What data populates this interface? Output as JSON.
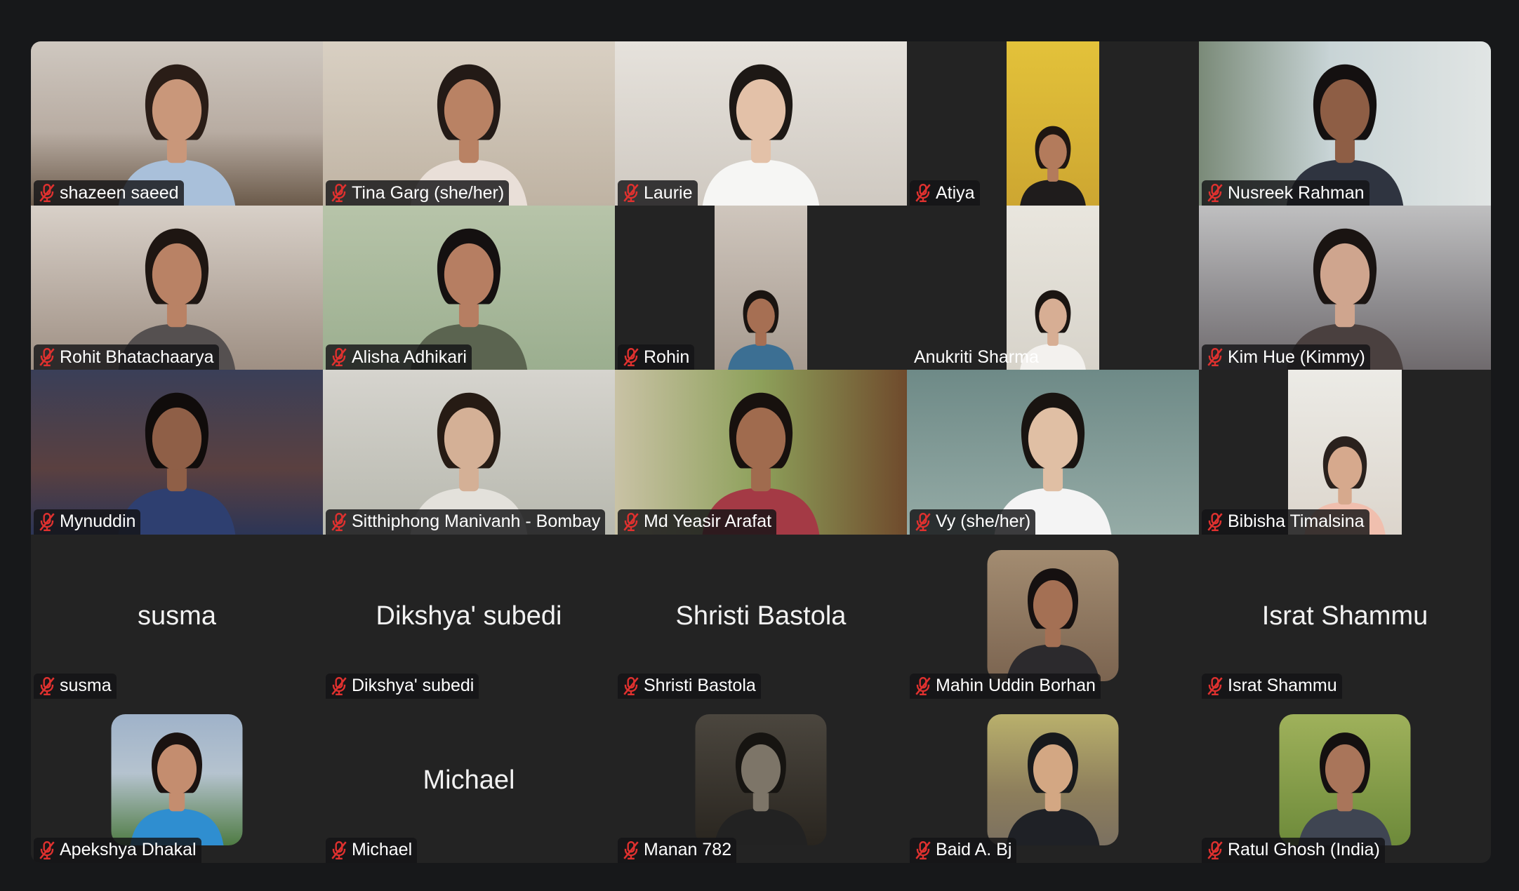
{
  "participants": [
    {
      "name": "shazeen saeed",
      "muted": true,
      "video": "full",
      "bg": "linear-gradient(180deg,#cfc8c0 0%,#b8aca2 55%,#6b5a4a 100%)",
      "skin": "#c9977a",
      "hair": "#2a1d17",
      "shirt": "#a9c0da"
    },
    {
      "name": "Tina Garg (she/her)",
      "muted": true,
      "video": "full",
      "bg": "linear-gradient(180deg,#d9d0c3 0%,#bfb3a3 100%)",
      "skin": "#b98264",
      "hair": "#231a16",
      "shirt": "#e9dfd8"
    },
    {
      "name": "Laurie",
      "muted": true,
      "video": "full",
      "bg": "linear-gradient(180deg,#e6e2dc 0%,#cfc9c1 100%)",
      "skin": "#e3c1a8",
      "hair": "#1d1815",
      "shirt": "#f6f6f4"
    },
    {
      "name": "Atiya",
      "muted": true,
      "video": "mid",
      "bg": "linear-gradient(180deg,#e3c23a 0%,#cda631 100%)",
      "skin": "#b37b5c",
      "hair": "#1e1612",
      "shirt": "#1f1c1c"
    },
    {
      "name": "Nusreek Rahman",
      "muted": true,
      "video": "full",
      "bg": "linear-gradient(90deg,#7a8a78 0%,#c8d4d6 45%,#e1e5e4 100%)",
      "skin": "#8e5e45",
      "hair": "#141010",
      "shirt": "#2f3440"
    },
    {
      "name": "Rohit Bhatachaarya",
      "muted": true,
      "video": "full",
      "bg": "linear-gradient(180deg,#d8d0c8 0%,#9e8f83 100%)",
      "skin": "#b98265",
      "hair": "#1e1612",
      "shirt": "#555050"
    },
    {
      "name": "Alisha Adhikari",
      "muted": true,
      "video": "full",
      "bg": "linear-gradient(180deg,#b7c4a9 0%,#9bae8f 100%)",
      "skin": "#b67e62",
      "hair": "#141010",
      "shirt": "#5b6450"
    },
    {
      "name": "Rohin",
      "muted": true,
      "video": "mid",
      "bg": "linear-gradient(180deg,#cfc6bd 0%,#a69a8f 100%)",
      "skin": "#a66f53",
      "hair": "#1a1411",
      "shirt": "#3c6f93"
    },
    {
      "name": "Anukriti Sharma",
      "muted": false,
      "video": "mid",
      "bg": "linear-gradient(180deg,#e9e6de 0%,#d7d3ca 100%)",
      "skin": "#d7ae94",
      "hair": "#1b1512",
      "shirt": "#f3f1ee"
    },
    {
      "name": "Kim Hue (Kimmy)",
      "muted": true,
      "video": "full",
      "bg": "linear-gradient(180deg,#bfbfc0 0%,#8d8b8e 60%,#6f6a6d 100%)",
      "skin": "#cfa58e",
      "hair": "#1a1412",
      "shirt": "#4a403f"
    },
    {
      "name": "Mynuddin",
      "muted": true,
      "video": "full",
      "bg": "linear-gradient(180deg,#3a3f58 0%,#5a4040 60%,#2c3556 100%)",
      "skin": "#8f5f47",
      "hair": "#100c0b",
      "shirt": "#2e3f70"
    },
    {
      "name": "Sitthiphong Manivanh - Bombay",
      "muted": true,
      "video": "full",
      "bg": "linear-gradient(180deg,#d6d4ce 0%,#b7b8ae 100%)",
      "skin": "#d4b096",
      "hair": "#261b14",
      "shirt": "#e3e1db"
    },
    {
      "name": "Md Yeasir Arafat",
      "muted": true,
      "video": "full",
      "bg": "linear-gradient(90deg,#c9c2a5 0%,#8da05a 50%,#6f4a2c 100%)",
      "skin": "#a06b4e",
      "hair": "#17110e",
      "shirt": "#a43a45"
    },
    {
      "name": "Vy (she/her)",
      "muted": true,
      "video": "full",
      "bg": "linear-gradient(180deg,#6e8a87 0%,#95aba6 100%)",
      "skin": "#e0bfa4",
      "hair": "#191411",
      "shirt": "#f4f4f4"
    },
    {
      "name": "Bibisha Timalsina",
      "muted": true,
      "video": "wide",
      "bg": "linear-gradient(180deg,#ecebe6 0%,#dcd5cc 100%)",
      "skin": "#d6a98d",
      "hair": "#2a211d",
      "shirt": "#f0bfae"
    },
    {
      "name": "susma",
      "muted": true,
      "video": "off"
    },
    {
      "name": "Dikshya' subedi",
      "muted": true,
      "video": "off"
    },
    {
      "name": "Shristi Bastola",
      "muted": true,
      "video": "off"
    },
    {
      "name": "Mahin Uddin Borhan",
      "muted": true,
      "video": "avatar",
      "bg": "linear-gradient(180deg,#a38c71 0%,#7b6450 100%)",
      "skin": "#a47054",
      "hair": "#151010",
      "shirt": "#2c2a2d"
    },
    {
      "name": "Israt Shammu",
      "muted": true,
      "video": "off"
    },
    {
      "name": "Apekshya Dhakal",
      "muted": true,
      "video": "avatar",
      "bg": "linear-gradient(180deg,#9fb2c9 0%,#b5c3cf 45%,#4f7b43 100%)",
      "skin": "#c48d6f",
      "hair": "#1a1210",
      "shirt": "#2f8ed0"
    },
    {
      "name": "Michael",
      "muted": true,
      "video": "off"
    },
    {
      "name": "Manan 782",
      "muted": true,
      "video": "avatar",
      "bg": "linear-gradient(180deg,#4b463e 0%,#29251f 100%)",
      "skin": "#7d7568",
      "hair": "#161411",
      "shirt": "#222"
    },
    {
      "name": "Baid A. Bj",
      "muted": true,
      "video": "avatar",
      "bg": "linear-gradient(180deg,#b9b06c 0%,#8d7e5c 60%,#7b7060 100%)",
      "skin": "#d3a783",
      "hair": "#17191c",
      "shirt": "#1f2126"
    },
    {
      "name": "Ratul Ghosh (India)",
      "muted": true,
      "video": "avatar",
      "bg": "linear-gradient(180deg,#9fb15b 0%,#6d8a3a 100%)",
      "skin": "#a9755a",
      "hair": "#141010",
      "shirt": "#3f4552"
    }
  ]
}
